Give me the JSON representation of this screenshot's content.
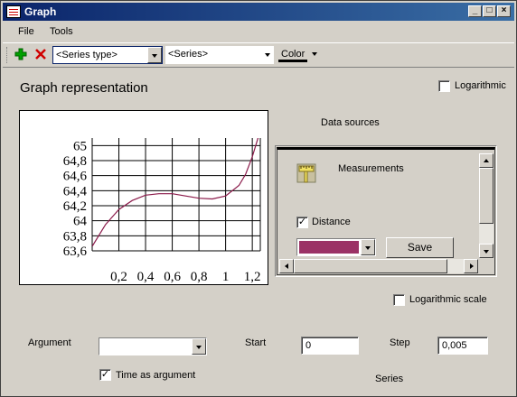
{
  "window": {
    "title": "Graph"
  },
  "menu": [
    "File",
    "Tools"
  ],
  "toolbar": {
    "series_type": "<Series type>",
    "series": "<Series>",
    "color_label": "Color"
  },
  "heading": "Graph representation",
  "logarithmic_label": "Logarithmic",
  "data_sources": {
    "title": "Data sources",
    "measurements_label": "Measurements",
    "distance_label": "Distance",
    "distance_checked": true,
    "swatch_color": "#9b3265",
    "save_label": "Save"
  },
  "logarithmic_scale_label": "Logarithmic scale",
  "argument": {
    "label": "Argument",
    "value": ""
  },
  "start": {
    "label": "Start",
    "value": "0"
  },
  "step": {
    "label": "Step",
    "value": "0,005"
  },
  "time_as_argument": {
    "label": "Time as argument",
    "checked": true
  },
  "series_label": "Series",
  "colors": {
    "titlebar_start": "#0a246a",
    "titlebar_end": "#3a6ea5",
    "curve": "#8b1a4a",
    "add": "#00a000",
    "delete": "#d00000"
  },
  "chart_data": {
    "type": "line",
    "title": "",
    "xlabel": "",
    "ylabel": "",
    "xlim": [
      0,
      1.26
    ],
    "ylim": [
      63.6,
      65.1
    ],
    "x_ticks": [
      "0,2",
      "0,4",
      "0,6",
      "0,8",
      "1",
      "1,2"
    ],
    "y_ticks": [
      "65",
      "64,8",
      "64,6",
      "64,4",
      "64,2",
      "64",
      "63,8",
      "63,6"
    ],
    "grid": true,
    "series": [
      {
        "values": [
          [
            0.0,
            63.66
          ],
          [
            0.1,
            63.95
          ],
          [
            0.2,
            64.15
          ],
          [
            0.3,
            64.27
          ],
          [
            0.4,
            64.34
          ],
          [
            0.5,
            64.36
          ],
          [
            0.6,
            64.36
          ],
          [
            0.7,
            64.33
          ],
          [
            0.8,
            64.3
          ],
          [
            0.9,
            64.29
          ],
          [
            1.0,
            64.33
          ],
          [
            1.1,
            64.47
          ],
          [
            1.15,
            64.62
          ],
          [
            1.2,
            64.85
          ],
          [
            1.26,
            65.2
          ]
        ]
      }
    ]
  }
}
